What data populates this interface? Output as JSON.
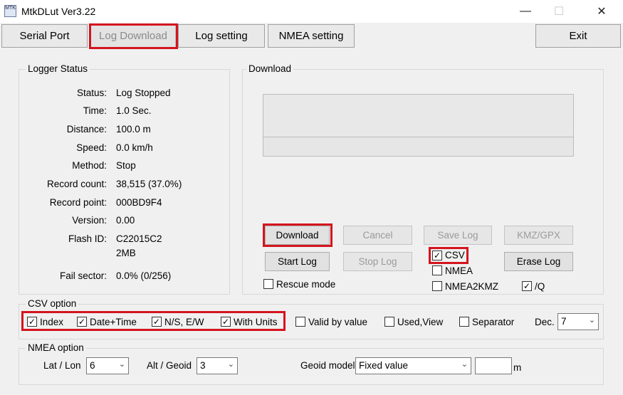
{
  "window": {
    "title": "MtkDLut Ver3.22",
    "icon_text": "MTK"
  },
  "tabs": {
    "serial_port": "Serial Port",
    "log_download": "Log Download",
    "log_setting": "Log setting",
    "nmea_setting": "NMEA setting",
    "exit": "Exit"
  },
  "logger_status": {
    "title": "Logger Status",
    "rows": [
      {
        "label": "Status:",
        "value": "Log Stopped"
      },
      {
        "label": "Time:",
        "value": "1.0 Sec."
      },
      {
        "label": "Distance:",
        "value": "100.0 m"
      },
      {
        "label": "Speed:",
        "value": "0.0 km/h"
      },
      {
        "label": "Method:",
        "value": "Stop"
      },
      {
        "label": "Record count:",
        "value": "38,515 (37.0%)"
      },
      {
        "label": "Record point:",
        "value": "000BD9F4"
      },
      {
        "label": "Version:",
        "value": "0.00"
      },
      {
        "label": "Flash ID:",
        "value": "C22015C2"
      },
      {
        "label": "",
        "value": "2MB"
      },
      {
        "label": "Fail sector:",
        "value": "0.0% (0/256)"
      }
    ]
  },
  "download": {
    "title": "Download",
    "buttons": {
      "download": "Download",
      "cancel": "Cancel",
      "save_log": "Save Log",
      "kmz_gpx": "KMZ/GPX",
      "start_log": "Start Log",
      "stop_log": "Stop Log",
      "erase_log": "Erase Log"
    },
    "checks": {
      "csv": "CSV",
      "nmea": "NMEA",
      "nmea2kmz": "NMEA2KMZ",
      "q": "/Q",
      "rescue_mode": "Rescue mode"
    }
  },
  "csv_option": {
    "title": "CSV option",
    "index": "Index",
    "date_time": "Date+Time",
    "ns_ew": "N/S, E/W",
    "with_units": "With Units",
    "valid_by_value": "Valid by value",
    "used_view": "Used,View",
    "separator": "Separator",
    "dec_label": "Dec.",
    "dec_value": "7"
  },
  "nmea_option": {
    "title": "NMEA option",
    "lat_lon_label": "Lat / Lon",
    "lat_lon_value": "6",
    "alt_geoid_label": "Alt / Geoid",
    "alt_geoid_value": "3",
    "geoid_model_label": "Geoid model",
    "geoid_model_value": "Fixed value",
    "geoid_value": "",
    "unit": "m"
  },
  "colors": {
    "highlight": "#d4141e",
    "background": "#f0f0f0"
  }
}
